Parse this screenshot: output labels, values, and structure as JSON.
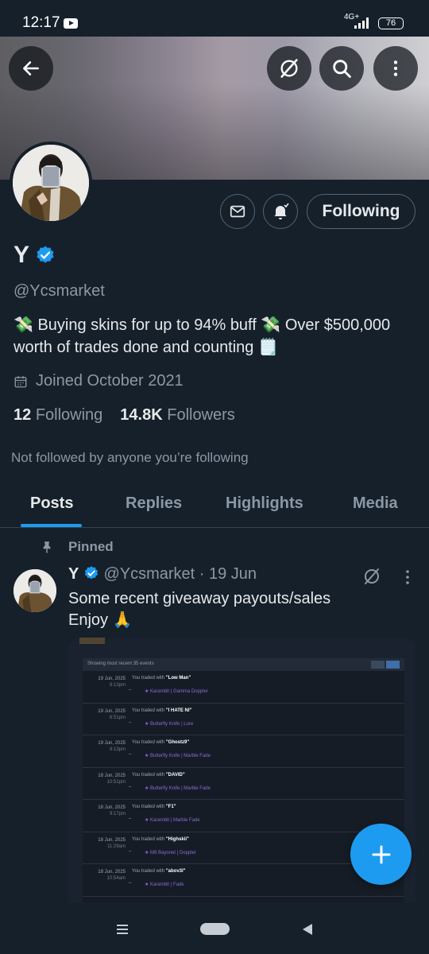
{
  "status_bar": {
    "time": "12:17",
    "network": "4G+",
    "battery": "76"
  },
  "profile": {
    "name": "Y",
    "handle": "@Ycsmarket",
    "bio": "💸 Buying skins for up to 94% buff 💸 Over $500,000 worth of trades done and counting 🗒️",
    "joined": "Joined October 2021",
    "following_count": "12",
    "following_label": "Following",
    "followers_count": "14.8K",
    "followers_label": "Followers",
    "not_followed": "Not followed by anyone you’re following",
    "follow_button": "Following"
  },
  "tabs": [
    "Posts",
    "Replies",
    "Highlights",
    "Media"
  ],
  "post": {
    "pinned_label": "Pinned",
    "name": "Y",
    "handle_time": "@Ycsmarket · 19 Jun",
    "line1": "Some recent giveaway payouts/sales",
    "line2": "Enjoy 🙏",
    "media": {
      "header": "Showing most recent 35 events",
      "rows": [
        {
          "date": "19 Jun, 2025",
          "time": "8:13pm",
          "prefix": "You traded with ",
          "user": "\"Low Man\"",
          "item": "★ Karambit | Gamma Doppler"
        },
        {
          "date": "19 Jun, 2025",
          "time": "6:51pm",
          "prefix": "You traded with ",
          "user": "\"I HATE NI\"",
          "item": "★ Butterfly Knife | Lore"
        },
        {
          "date": "19 Jun, 2025",
          "time": "8:13pm",
          "prefix": "You traded with ",
          "user": "\"Ghostz9\"",
          "item": "★ Butterfly Knife | Marble Fade"
        },
        {
          "date": "18 Jun, 2025",
          "time": "10:51pm",
          "prefix": "You traded with ",
          "user": "\"DAVID\"",
          "item": "★ Butterfly Knife | Marble Fade"
        },
        {
          "date": "18 Jun, 2025",
          "time": "9:17pm",
          "prefix": "You traded with ",
          "user": "\"F1\"",
          "item": "★ Karambit | Marble Fade"
        },
        {
          "date": "18 Jun, 2025",
          "time": "11:29am",
          "prefix": "You traded with ",
          "user": "\"Highskii\"",
          "item": "★ M9 Bayonet | Doppler"
        },
        {
          "date": "18 Jun, 2025",
          "time": "10:54am",
          "prefix": "You traded with ",
          "user": "\"abov3l\"",
          "item": "★ Karambit | Fade"
        }
      ]
    }
  },
  "colors": {
    "background": "#15202b",
    "accent": "#1d9bf0",
    "muted": "#8b98a5",
    "text": "#e7e9ea"
  },
  "icons": [
    "back-arrow-icon",
    "grok-icon",
    "search-icon",
    "more-vertical-icon",
    "mail-icon",
    "bell-icon",
    "verified-badge-icon",
    "calendar-icon",
    "pin-icon",
    "plus-icon"
  ]
}
